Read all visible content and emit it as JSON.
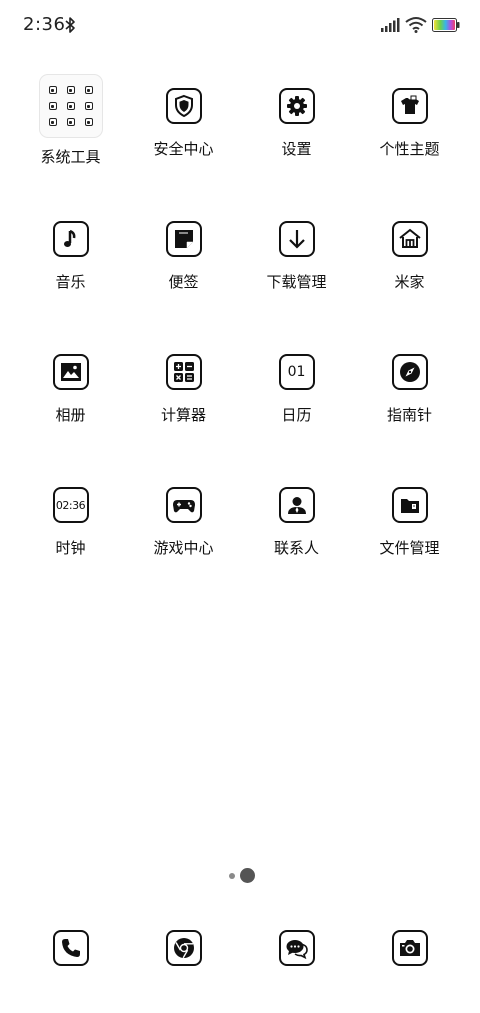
{
  "status_bar": {
    "time": "2:36",
    "icons": [
      "bluetooth-icon",
      "signal-icon",
      "wifi-icon",
      "battery-icon"
    ]
  },
  "apps": [
    {
      "label": "系统工具",
      "icon": "folder-icon"
    },
    {
      "label": "安全中心",
      "icon": "shield-icon"
    },
    {
      "label": "设置",
      "icon": "gear-icon"
    },
    {
      "label": "个性主题",
      "icon": "theme-shirt-icon"
    },
    {
      "label": "音乐",
      "icon": "music-note-icon"
    },
    {
      "label": "便签",
      "icon": "notes-icon"
    },
    {
      "label": "下载管理",
      "icon": "download-arrow-icon"
    },
    {
      "label": "米家",
      "icon": "home-icon"
    },
    {
      "label": "相册",
      "icon": "gallery-icon"
    },
    {
      "label": "计算器",
      "icon": "calculator-icon"
    },
    {
      "label": "日历",
      "icon": "calendar-icon",
      "icon_text": "01"
    },
    {
      "label": "指南针",
      "icon": "compass-icon"
    },
    {
      "label": "时钟",
      "icon": "clock-icon",
      "icon_text": "02:36"
    },
    {
      "label": "游戏中心",
      "icon": "gamepad-icon"
    },
    {
      "label": "联系人",
      "icon": "contact-icon"
    },
    {
      "label": "文件管理",
      "icon": "file-manager-icon"
    }
  ],
  "page_indicator": {
    "pages": 2,
    "current": 2
  },
  "dock": [
    {
      "icon": "phone-icon"
    },
    {
      "icon": "browser-icon"
    },
    {
      "icon": "messages-icon"
    },
    {
      "icon": "camera-icon"
    }
  ],
  "colors": {
    "background": "#ffffff",
    "icon_stroke": "#111111",
    "indicator": "#555555"
  }
}
